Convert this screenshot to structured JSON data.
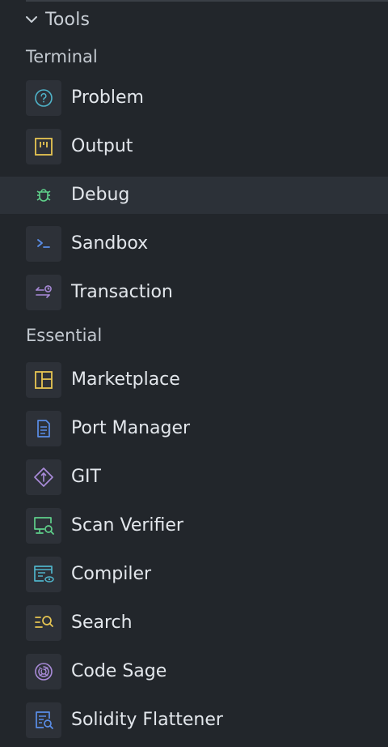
{
  "header": {
    "title": "Tools",
    "chevron_icon": "chevron-down-icon"
  },
  "sections": {
    "terminal": {
      "label": "Terminal",
      "items": [
        {
          "label": "Problem",
          "icon": "question-circle-icon",
          "color": "#4fb3c9"
        },
        {
          "label": "Output",
          "icon": "output-icon",
          "color": "#e6c552"
        },
        {
          "label": "Debug",
          "icon": "bug-icon",
          "color": "#5fd08a",
          "active": true
        },
        {
          "label": "Sandbox",
          "icon": "terminal-prompt-icon",
          "color": "#5a8ee8"
        },
        {
          "label": "Transaction",
          "icon": "transaction-icon",
          "color": "#a98bd9"
        }
      ]
    },
    "essential": {
      "label": "Essential",
      "items": [
        {
          "label": "Marketplace",
          "icon": "layout-grid-icon",
          "color": "#e6c552"
        },
        {
          "label": "Port Manager",
          "icon": "document-icon",
          "color": "#5a8ee8"
        },
        {
          "label": "GIT",
          "icon": "git-diamond-icon",
          "color": "#a98bd9"
        },
        {
          "label": "Scan Verifier",
          "icon": "monitor-search-icon",
          "color": "#5fd08a"
        },
        {
          "label": "Compiler",
          "icon": "compiler-window-icon",
          "color": "#4fb3c9"
        },
        {
          "label": "Search",
          "icon": "list-search-icon",
          "color": "#e6c552"
        },
        {
          "label": "Code Sage",
          "icon": "ai-swirl-icon",
          "color": "#a98bd9"
        },
        {
          "label": "Solidity Flattener",
          "icon": "file-search-icon",
          "color": "#5a8ee8"
        }
      ]
    }
  },
  "colors": {
    "background": "#22262b",
    "active_row": "#2c3138",
    "icon_tile": "#2d3138"
  }
}
